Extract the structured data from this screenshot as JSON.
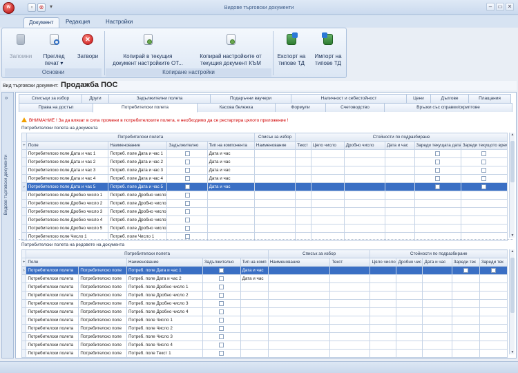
{
  "window": {
    "title": "Видове търговски документи",
    "app_icon_text": "W"
  },
  "quick_access": [
    "▫",
    "⊗",
    "▾"
  ],
  "window_controls": {
    "minimize": "–",
    "maximize": "▭",
    "close": "✕"
  },
  "ribbon_tabs": [
    "Документ",
    "Редакция",
    "Настройки"
  ],
  "ribbon": {
    "save": "Запомни",
    "preview_line1": "Преглед",
    "preview_line2": "печат ▾",
    "close": "Затвори",
    "group_main": "Основни",
    "copy_to_1": "Копирай в текущия",
    "copy_to_2": "документ настройките ОТ...",
    "copy_from_1": "Копирай настройките от",
    "copy_from_2": "текущия документ КЪМ",
    "group_copy": "Копиране настройки",
    "export_1": "Експорт на",
    "export_2": "типове ТД",
    "import_1": "Импорт на",
    "import_2": "типове ТД"
  },
  "doc_type": {
    "label": "Вид търговски документ:",
    "value": "Продажба ПОС"
  },
  "sidebar": {
    "title": "Видове търговски документи",
    "arrow": "»"
  },
  "tabs_row1": [
    "Списъци за избор",
    "Други",
    "Задължителни полета",
    "Подаръчни ваучери",
    "Наличност и себестойност",
    "Цени",
    "Дългове",
    "Плащания"
  ],
  "tabs_row2": [
    "Права на достъп",
    "Потребителски полета",
    "Касова бележка",
    "Формули",
    "Счетоводство",
    "Връзки със справки/скриптове"
  ],
  "warning": "ВНИМАНИЕ ! За да влязат в сила промени в потребителските полета, е необходимо да се рестартира цялото приложение !",
  "section1": {
    "title": "Потребителски полета на документа",
    "bands": [
      "Потребителски полета",
      "Списък за избор",
      "Стойности по подразбиране"
    ],
    "columns": [
      "Поле",
      "Наименование",
      "Задължително",
      "Тип на компонента",
      "Наименование",
      "Текст",
      "Цяло число",
      "Дробно число",
      "Дата и час",
      "Зареди текущата дата",
      "Зареди текущото време"
    ],
    "rows": [
      {
        "field": "Потребителско поле Дата и час 1",
        "name": "Потреб. поле Дата и час 1",
        "type": "Дата и час"
      },
      {
        "field": "Потребителско поле Дата и час 2",
        "name": "Потреб. поле Дата и час 2",
        "type": "Дата и час"
      },
      {
        "field": "Потребителско поле Дата и час 3",
        "name": "Потреб. поле Дата и час 3",
        "type": "Дата и час"
      },
      {
        "field": "Потребителско поле Дата и час 4",
        "name": "Потреб. поле Дата и час 4",
        "type": "Дата и час"
      },
      {
        "field": "Потребителско поле Дата и час 5",
        "name": "Потреб. поле Дата и час 5",
        "type": "Дата и час"
      },
      {
        "field": "Потребителско поле Дробно число 1",
        "name": "Потреб. поле Дробно число",
        "type": ""
      },
      {
        "field": "Потребителско поле Дробно число 2",
        "name": "Потреб. поле Дробно число",
        "type": ""
      },
      {
        "field": "Потребителско поле Дробно число 3",
        "name": "Потреб. поле Дробно число",
        "type": ""
      },
      {
        "field": "Потребителско поле Дробно число 4",
        "name": "Потреб. поле Дробно число",
        "type": ""
      },
      {
        "field": "Потребителско поле Дробно число 5",
        "name": "Потреб. поле Дробно число",
        "type": ""
      },
      {
        "field": "Потребителско поле Число 1",
        "name": "Потреб. поле Число 1",
        "type": ""
      }
    ]
  },
  "section2": {
    "title": "Потребителски полета на редовете на документа",
    "bands": [
      "Потребителски полета",
      "Списък за избор",
      "Стойности по подразбиране"
    ],
    "columns": [
      "Поле",
      "Наименование",
      "Задължително",
      "Тип на комп",
      "Наименование",
      "Текст",
      "Цяло число",
      "Дробно чис",
      "Дата и час",
      "Зареди тек",
      "Зареди тек"
    ],
    "rows": [
      {
        "field": "Потребителски полета",
        "field2": "Потребителско поле",
        "name": "Потреб. поле Дата и час 1",
        "type": "Дата и час"
      },
      {
        "field": "Потребителски полета",
        "field2": "Потребителско поле",
        "name": "Потреб. поле Дата и час 2",
        "type": "Дата и час"
      },
      {
        "field": "Потребителски полета",
        "field2": "Потребителско поле",
        "name": "Потреб. поле Дробно число 1",
        "type": ""
      },
      {
        "field": "Потребителски полета",
        "field2": "Потребителско поле",
        "name": "Потреб. поле Дробно число 2",
        "type": ""
      },
      {
        "field": "Потребителски полета",
        "field2": "Потребителско поле",
        "name": "Потреб. поле Дробно число 3",
        "type": ""
      },
      {
        "field": "Потребителски полета",
        "field2": "Потребителско поле",
        "name": "Потреб. поле Дробно число 4",
        "type": ""
      },
      {
        "field": "Потребителски полета",
        "field2": "Потребителско поле",
        "name": "Потреб. поле Число 1",
        "type": ""
      },
      {
        "field": "Потребителски полета",
        "field2": "Потребителско поле",
        "name": "Потреб. поле Число 2",
        "type": ""
      },
      {
        "field": "Потребителски полета",
        "field2": "Потребителско поле",
        "name": "Потреб. поле Число 3",
        "type": ""
      },
      {
        "field": "Потребителски полета",
        "field2": "Потребителско поле",
        "name": "Потреб. поле Число 4",
        "type": ""
      },
      {
        "field": "Потребителски полета",
        "field2": "Потребителско поле",
        "name": "Потреб. поле Текст 1",
        "type": ""
      }
    ]
  },
  "colors": {
    "selection": "#3a6fc4",
    "warning": "#d00000",
    "ribbon_text": "#1b3157"
  }
}
